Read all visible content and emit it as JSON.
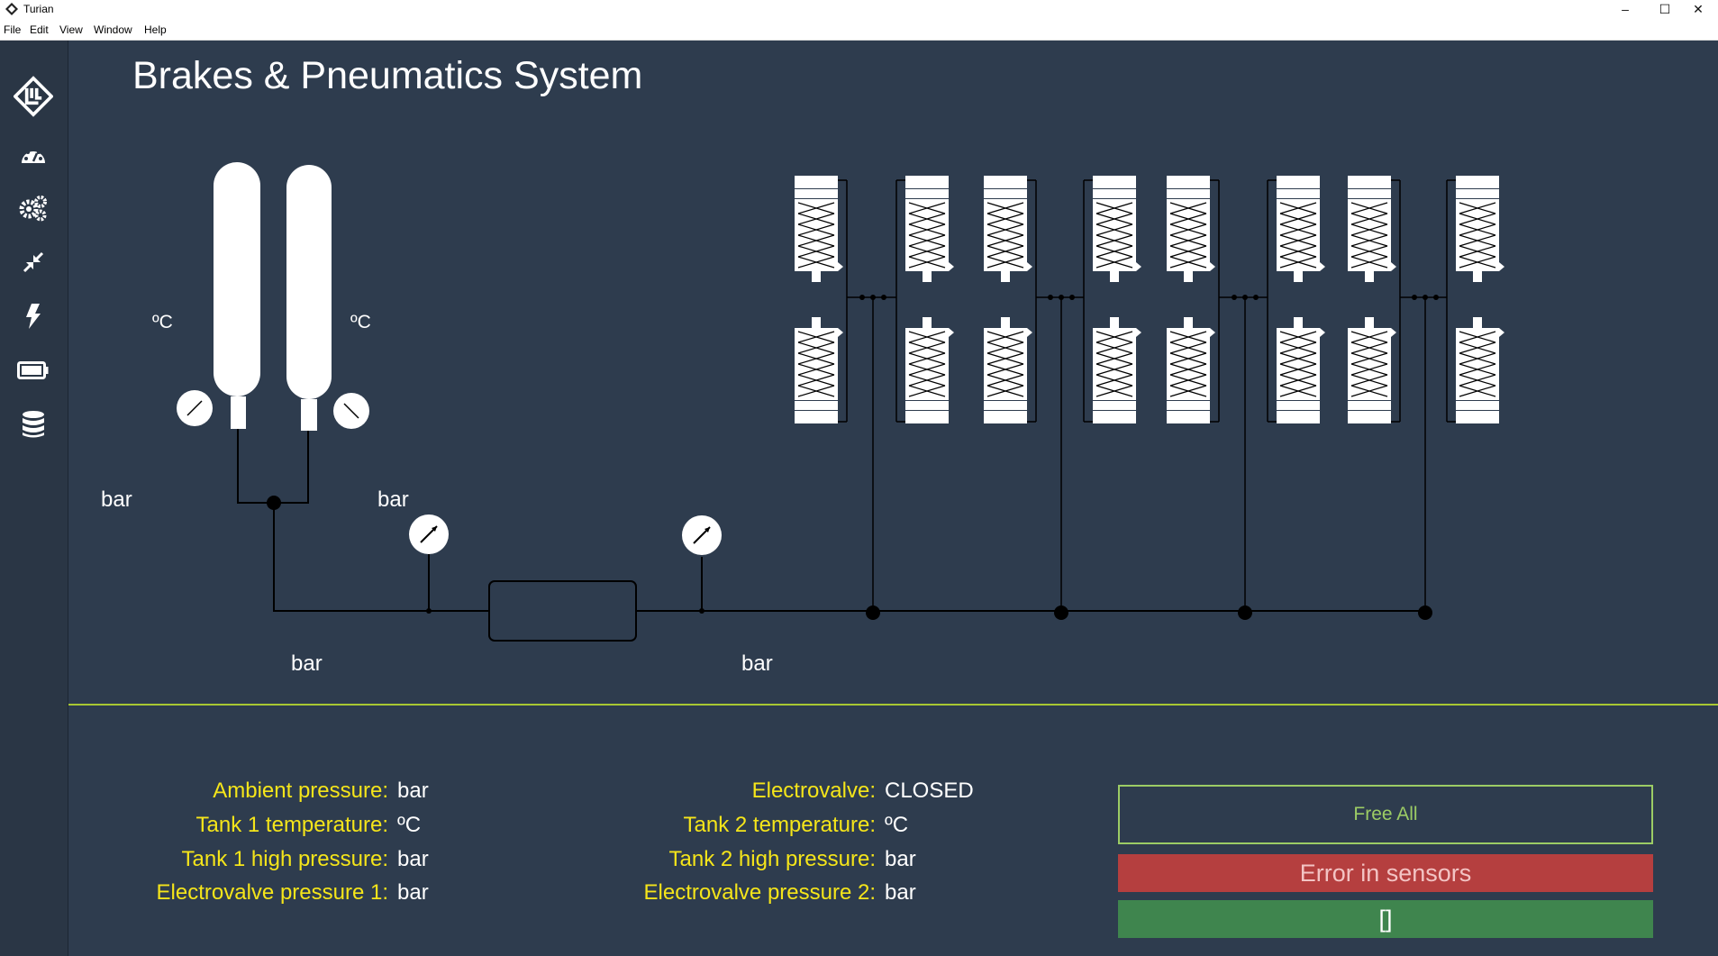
{
  "window": {
    "title": "Turian",
    "minimize_glyph": "–",
    "maximize_glyph": "☐",
    "close_glyph": "✕"
  },
  "menu": {
    "items": [
      {
        "label": "File"
      },
      {
        "label": "Edit"
      },
      {
        "label": "View"
      },
      {
        "label": "Window"
      },
      {
        "label": "Help"
      }
    ]
  },
  "sidebar": {
    "items": [
      {
        "icon": "logo-icon"
      },
      {
        "icon": "dashboard-gauge-icon"
      },
      {
        "icon": "gears-icon"
      },
      {
        "icon": "compress-arrows-icon"
      },
      {
        "icon": "lightning-bolt-icon"
      },
      {
        "icon": "battery-icon"
      },
      {
        "icon": "database-icon"
      }
    ]
  },
  "page": {
    "title": "Brakes & Pneumatics System"
  },
  "diagram": {
    "tank1_temp_unit": "ºC",
    "tank2_temp_unit": "ºC",
    "tank1_pressure_unit": "bar",
    "tank2_pressure_unit": "bar",
    "line_pressure_unit": "bar",
    "electrovalve_pressure_unit": "bar"
  },
  "status": {
    "left": [
      {
        "key": "Ambient pressure:",
        "value": "bar"
      },
      {
        "key": "Tank 1 temperature:",
        "value": "ºC"
      },
      {
        "key": "Tank 1 high pressure:",
        "value": "bar"
      },
      {
        "key": "Electrovalve pressure 1:",
        "value": "bar"
      }
    ],
    "right": [
      {
        "key": "Electrovalve:",
        "value": "CLOSED"
      },
      {
        "key": "Tank 2 temperature:",
        "value": "ºC"
      },
      {
        "key": "Tank 2 high pressure:",
        "value": "bar"
      },
      {
        "key": "Electrovalve pressure 2:",
        "value": "bar"
      }
    ]
  },
  "buttons": {
    "free_all": "Free All",
    "error": "Error in sensors",
    "ok": "[]"
  },
  "colors": {
    "background": "#2e3c4e",
    "sidebar": "#2a3645",
    "key_text": "#f5e51a",
    "separator": "#a8c832",
    "free_button_border": "#9ccc65",
    "error_button": "#b53f3f",
    "ok_button": "#3f854e"
  }
}
